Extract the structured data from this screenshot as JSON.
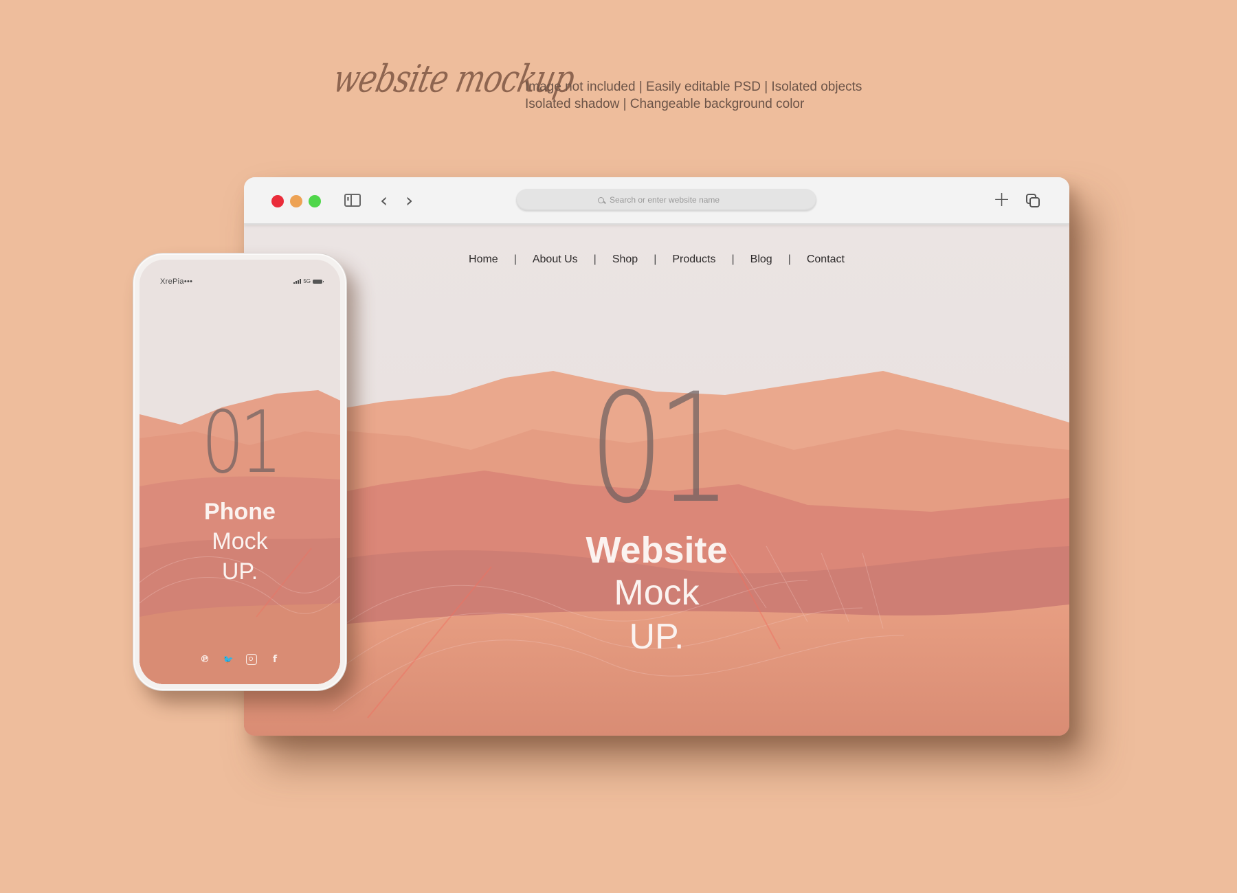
{
  "header": {
    "script_title": "website mockup",
    "features_line1": "Image not included  |  Easily editable PSD  |  Isolated objects",
    "features_line2": "Isolated shadow  |  Changeable background color"
  },
  "colors": {
    "background": "#eebd9c",
    "traffic_red": "#ea2c3a",
    "traffic_yellow": "#eda254",
    "traffic_green": "#4fd64a",
    "sky": "#e8e2e1",
    "dune": "#e39a80"
  },
  "browser": {
    "search_placeholder": "Search or enter website name",
    "icons": {
      "sidebar": "sidebar-toggle-icon",
      "back": "chevron-left-icon",
      "forward": "chevron-right-icon",
      "new_tab": "plus-icon",
      "tabs": "tabs-overview-icon"
    },
    "glyphs": {
      "back": "‹",
      "forward": "›",
      "new_tab": "+"
    },
    "site": {
      "nav": [
        {
          "label": "Home"
        },
        {
          "label": "About Us"
        },
        {
          "label": "Shop"
        },
        {
          "label": "Products"
        },
        {
          "label": "Blog"
        },
        {
          "label": "Contact"
        }
      ],
      "separator": "|",
      "hero_number": "01",
      "hero_line1": "Website",
      "hero_line2": "Mock",
      "hero_line3": "UP."
    }
  },
  "phone": {
    "carrier": "XrePia•••",
    "network": "5G",
    "hero_number": "01",
    "hero_line1": "Phone",
    "hero_line2": "Mock",
    "hero_line3": "UP.",
    "socials": [
      {
        "name": "pinterest-icon",
        "glyph": "℗"
      },
      {
        "name": "twitter-icon",
        "glyph": "🐦"
      },
      {
        "name": "instagram-icon",
        "glyph": ""
      },
      {
        "name": "facebook-icon",
        "glyph": "f"
      }
    ]
  }
}
